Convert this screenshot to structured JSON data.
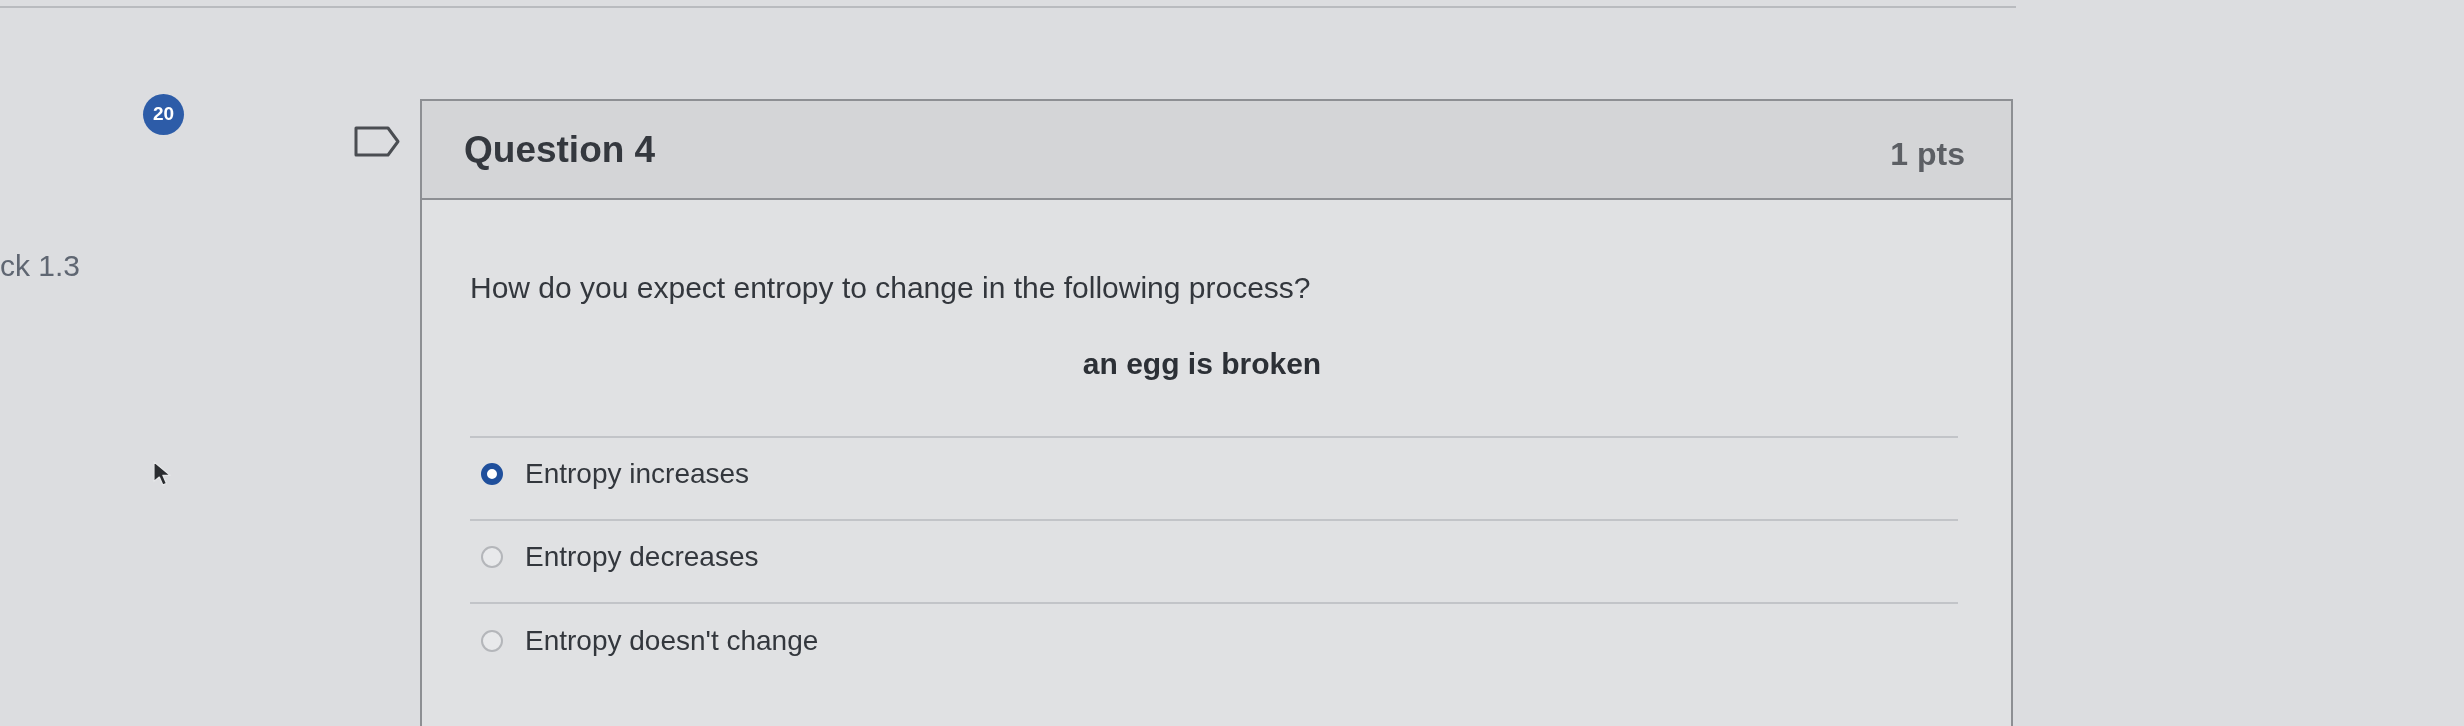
{
  "question_badge": "20",
  "side_label": "ck 1.3",
  "question": {
    "title": "Question 4",
    "points": "1 pts",
    "prompt": "How do you expect entropy to change in the following process?",
    "process": "an egg is broken",
    "answers": [
      {
        "label": "Entropy increases",
        "selected": true
      },
      {
        "label": "Entropy decreases",
        "selected": false
      },
      {
        "label": "Entropy doesn't change",
        "selected": false
      }
    ]
  }
}
